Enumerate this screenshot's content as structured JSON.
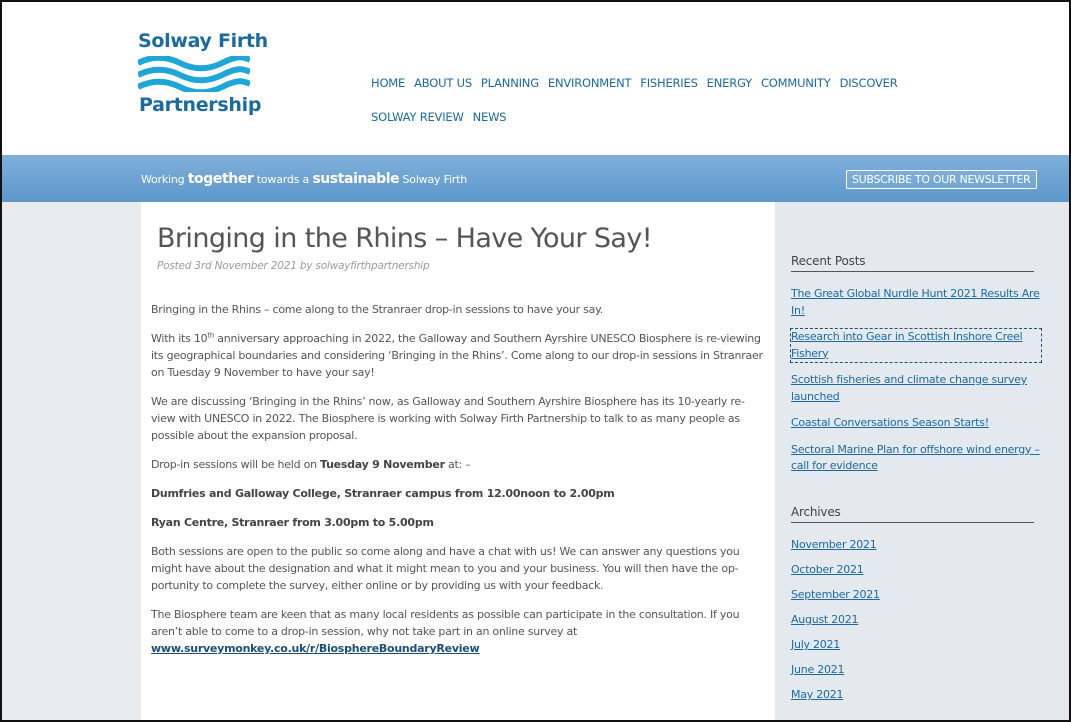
{
  "logo": {
    "line1": "Solway Firth",
    "line2": "Partnership"
  },
  "nav": {
    "row1": [
      "HOME",
      "ABOUT US",
      "PLANNING",
      "ENVIRONMENT",
      "FISHERIES",
      "ENERGY",
      "COMMUNITY",
      "DISCOVER"
    ],
    "row2": [
      "SOLWAY REVIEW",
      "NEWS"
    ]
  },
  "banner": {
    "tagline_pre": "Working ",
    "tagline_b1": "together",
    "tagline_mid": " towards a ",
    "tagline_b2": "sustainable",
    "tagline_post": " Solway Firth",
    "subscribe": "SUBSCRIBE TO OUR NEWSLETTER"
  },
  "post": {
    "title": "Bringing in the Rhins – Have Your Say!",
    "meta": "Posted 3rd November 2021 by solwayfirthpartnership",
    "p1": "Bringing in the Rhins – come along to the Stranraer drop-in sessions to have your say.",
    "p2_a": "With its 10",
    "p2_sup": "th",
    "p2_b": " anniversary approaching in 2022, the Galloway and Southern Ayrshire UNESCO Biosphere is re-viewing its geographical boundaries and considering ‘Bringing in the Rhins’. Come along to our drop-in sessions in Stranraer on Tuesday 9 November to have your say!",
    "p3": "We are discussing ‘Bringing in the Rhins’ now, as Galloway and Southern Ayrshire Biosphere has its 10-yearly re-view with UNESCO in 2022.  The Biosphere is working with Solway Firth Partnership to talk to as many people as possible about the expansion proposal.",
    "p4_a": "Drop-in sessions will be held on ",
    "p4_b": "Tuesday 9 November",
    "p4_c": " at: –",
    "p5": "Dumfries and Galloway College, Stranraer campus from 12.00noon to 2.00pm",
    "p6": "Ryan Centre, Stranraer from 3.00pm to 5.00pm",
    "p7": "Both sessions are open to the public so come along and have a chat with us! We can answer any questions you might have about the designation and what it might mean to you and your business. You will then have the op-portunity to complete the survey, either online or by providing us with your feedback.",
    "p8": "The Biosphere team are keen that as many local residents as possible can participate in the consultation. If you aren’t able to come to a drop-in session, why not take part in an online survey at",
    "p8_link": "www.surveymonkey.co.uk/r/BiosphereBoundaryReview"
  },
  "sidebar": {
    "recent_title": "Recent Posts",
    "recent": [
      "The Great Global Nurdle Hunt 2021 Results Are In!",
      "Research into Gear in Scottish Inshore Creel Fishery",
      "Scottish fisheries and climate change survey launched",
      "Coastal Conversations Season Starts!",
      "Sectoral Marine Plan for offshore wind energy – call for evidence"
    ],
    "archives_title": "Archives",
    "archives": [
      "November 2021",
      "October 2021",
      "September 2021",
      "August 2021",
      "July 2021",
      "June 2021",
      "May 2021"
    ]
  }
}
